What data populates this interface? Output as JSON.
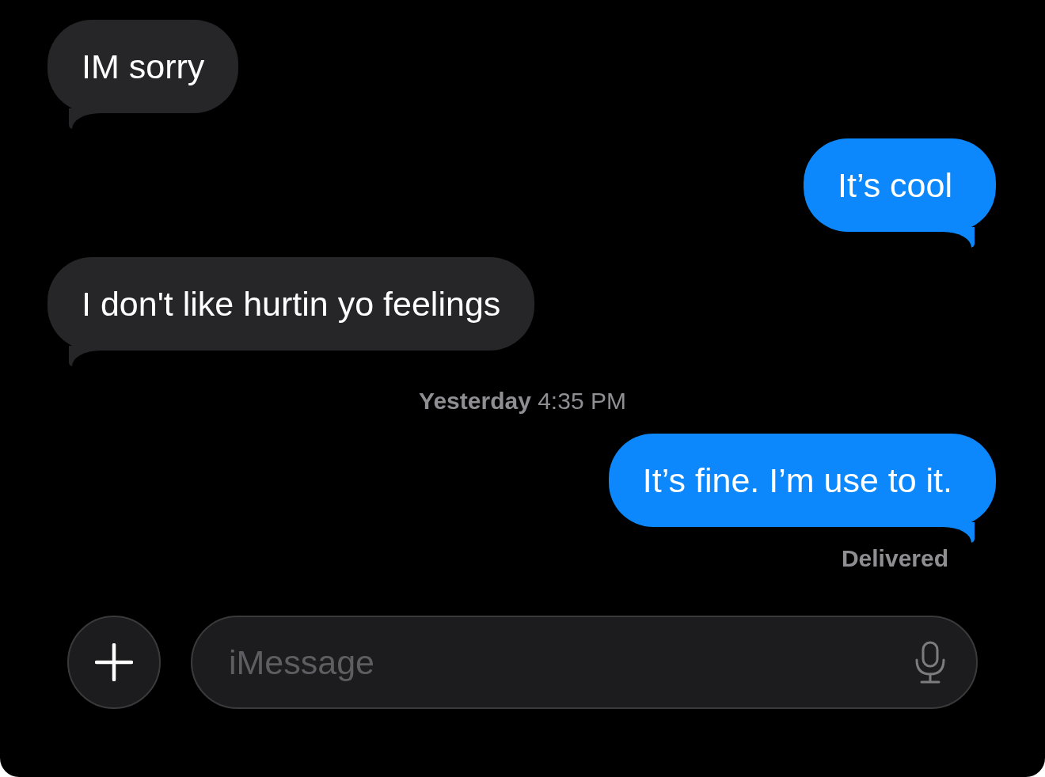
{
  "messages": [
    {
      "kind": "received",
      "text": "IM sorry"
    },
    {
      "kind": "sent",
      "text": "It’s cool"
    },
    {
      "kind": "received",
      "text": "I don't like hurtin yo feelings"
    },
    {
      "kind": "timestamp",
      "day": "Yesterday",
      "time": "4:35 PM"
    },
    {
      "kind": "sent",
      "text": "It’s fine. I’m use to it."
    }
  ],
  "status": "Delivered",
  "composer": {
    "placeholder": "iMessage"
  }
}
